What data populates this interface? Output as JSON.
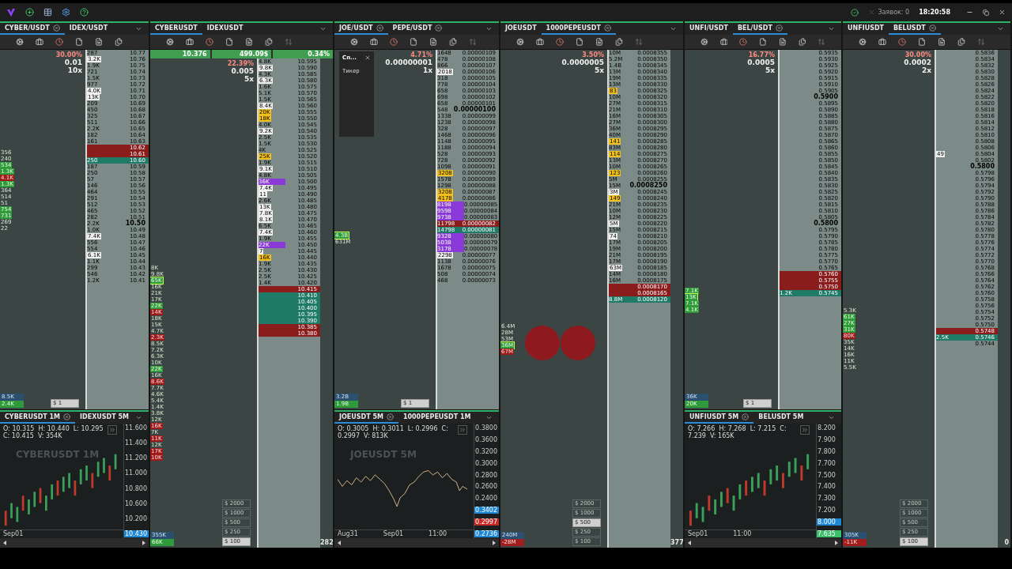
{
  "top_bar": {
    "status": "Заявок: 0",
    "time": "18:20:58"
  },
  "panels": [
    {
      "tabs": [
        {
          "label": "CYBER/USDT",
          "selected": true,
          "closable": true
        },
        {
          "label": "IDEX/USDT",
          "selected": false,
          "closable": false
        }
      ],
      "change": "30.00%",
      "step": "0.01",
      "multiplier": "10x",
      "trades": [
        {
          "text": "356",
          "kind": "text"
        },
        {
          "text": "240",
          "kind": "text"
        },
        {
          "text": "534",
          "kind": "buy"
        },
        {
          "text": "1.3K",
          "kind": "buy"
        },
        {
          "text": "4.1K",
          "kind": "sell"
        },
        {
          "text": "1.3K",
          "kind": "buy"
        },
        {
          "text": "364",
          "kind": "text"
        },
        {
          "text": "514",
          "kind": "text"
        },
        {
          "text": "51",
          "kind": "text"
        },
        {
          "text": "754",
          "kind": "buy"
        },
        {
          "text": "731",
          "kind": "buy"
        },
        {
          "text": "269",
          "kind": "text"
        },
        {
          "text": "22",
          "kind": "text"
        }
      ],
      "totals": [
        {
          "text": "8.5K",
          "kind": "total"
        },
        {
          "text": "2.4K",
          "kind": "buy"
        }
      ],
      "amounts": [
        {
          "label": "$ 1",
          "selected": true
        }
      ],
      "ladder": [
        {
          "price": "10.77",
          "volume": "287"
        },
        {
          "price": "10.76",
          "volume": "3.2K",
          "kind": "white"
        },
        {
          "price": "10.75",
          "volume": "1.9K"
        },
        {
          "price": "10.74",
          "volume": "721"
        },
        {
          "price": "10.73",
          "volume": "1.5K"
        },
        {
          "price": "10.72",
          "volume": "977"
        },
        {
          "price": "10.71",
          "volume": "4.0K",
          "kind": "white"
        },
        {
          "price": "10.70",
          "volume": "13K",
          "kind": "white"
        },
        {
          "price": "10.69",
          "volume": "209"
        },
        {
          "price": "10.68",
          "volume": "450"
        },
        {
          "price": "10.67",
          "volume": "325"
        },
        {
          "price": "10.66",
          "volume": "511"
        },
        {
          "price": "10.65",
          "volume": "2.2K"
        },
        {
          "price": "10.64",
          "volume": "182"
        },
        {
          "price": "10.63",
          "volume": "161"
        },
        {
          "price": "10.62",
          "kind": "ask"
        },
        {
          "price": "10.61",
          "kind": "ask"
        },
        {
          "price": "10.60",
          "volume": "250",
          "kind": "bid"
        },
        {
          "price": "10.59",
          "volume": "187"
        },
        {
          "price": "10.58",
          "volume": "250"
        },
        {
          "price": "10.57",
          "volume": "57"
        },
        {
          "price": "10.56",
          "volume": "146"
        },
        {
          "price": "10.55",
          "volume": "464"
        },
        {
          "price": "10.54",
          "volume": "291"
        },
        {
          "price": "10.53",
          "volume": "512"
        },
        {
          "price": "10.52",
          "volume": "465"
        },
        {
          "price": "10.51",
          "volume": "282"
        },
        {
          "price": "10.50",
          "volume": "2.2K",
          "kind": "round"
        },
        {
          "price": "10.49",
          "volume": "1.0K"
        },
        {
          "price": "10.48",
          "volume": "7.4K",
          "kind": "white"
        },
        {
          "price": "10.47",
          "volume": "556"
        },
        {
          "price": "10.46",
          "volume": "554"
        },
        {
          "price": "10.45",
          "volume": "6.1K",
          "kind": "white"
        },
        {
          "price": "10.44",
          "volume": "1.1K"
        },
        {
          "price": "10.43",
          "volume": "299"
        },
        {
          "price": "10.42",
          "volume": "546"
        },
        {
          "price": "10.41",
          "volume": "1.2K"
        }
      ],
      "chart": {
        "tabs": [
          {
            "label": "CYBERUSDT 1M",
            "selected": true,
            "closable": true
          },
          {
            "label": "IDEXUSDT 5M",
            "selected": false,
            "closable": false
          }
        ],
        "ohlc": "O: 10.315  H: 10.440  L: 10.295  C: 10.415  V: 354K",
        "watermark": "CYBERUSDT 1M",
        "kind": "candles",
        "y_labels": [
          "11.600",
          "11.400",
          "11.200",
          "11.000",
          "10.800",
          "10.600",
          "10.200"
        ],
        "price_tags": [
          {
            "text": "10.430",
            "kind": "blue"
          }
        ],
        "x_labels": [
          "Sep01"
        ]
      }
    },
    {
      "tabs": [
        {
          "label": "CYBERUSDT",
          "selected": true,
          "closable": false
        },
        {
          "label": "IDEXUSDT",
          "selected": false,
          "closable": false
        }
      ],
      "stats": [
        "10.376",
        "499.09$",
        "0.34%"
      ],
      "change": "22.39%",
      "step": "0.005",
      "multiplier": "5x",
      "counter": "282",
      "trades": [
        {
          "text": "8K",
          "kind": "text"
        },
        {
          "text": "9.8K",
          "kind": "text"
        },
        {
          "text": "65K",
          "kind": "big"
        },
        {
          "text": "16K",
          "kind": "text"
        },
        {
          "text": "21K",
          "kind": "text"
        },
        {
          "text": "17K",
          "kind": "text"
        },
        {
          "text": "22K",
          "kind": "buy"
        },
        {
          "text": "14K",
          "kind": "sell"
        },
        {
          "text": "18K",
          "kind": "text"
        },
        {
          "text": "15K",
          "kind": "text"
        },
        {
          "text": "4.7K",
          "kind": "text"
        },
        {
          "text": "2.3K",
          "kind": "sell"
        },
        {
          "text": "8.5K",
          "kind": "text"
        },
        {
          "text": "7.2K",
          "kind": "text"
        },
        {
          "text": "6.3K",
          "kind": "text"
        },
        {
          "text": "10K",
          "kind": "text"
        },
        {
          "text": "22K",
          "kind": "buy"
        },
        {
          "text": "16K",
          "kind": "text"
        },
        {
          "text": "8.6K",
          "kind": "sell"
        },
        {
          "text": "7.7K",
          "kind": "text"
        },
        {
          "text": "4.6K",
          "kind": "text"
        },
        {
          "text": "5.4K",
          "kind": "text"
        },
        {
          "text": "1.4K",
          "kind": "text"
        },
        {
          "text": "3.8K",
          "kind": "text"
        },
        {
          "text": "12K",
          "kind": "text"
        },
        {
          "text": "16K",
          "kind": "sell"
        },
        {
          "text": "7K",
          "kind": "text"
        },
        {
          "text": "11K",
          "kind": "sell"
        },
        {
          "text": "12K",
          "kind": "text"
        },
        {
          "text": "17K",
          "kind": "sell"
        },
        {
          "text": "10K",
          "kind": "sell"
        }
      ],
      "totals": [
        {
          "text": "355K",
          "kind": "total"
        },
        {
          "text": "66K",
          "kind": "buy"
        }
      ],
      "amounts": [
        {
          "label": "$ 2000",
          "selected": false
        },
        {
          "label": "$ 1000",
          "selected": false
        },
        {
          "label": "$ 500",
          "selected": false
        },
        {
          "label": "$ 250",
          "selected": false
        },
        {
          "label": "$ 100",
          "selected": true
        }
      ],
      "ladder": [
        {
          "price": "10.595",
          "volume": "4.8K"
        },
        {
          "price": "10.590",
          "volume": "9.8K",
          "kind": "white"
        },
        {
          "price": "10.585",
          "volume": "4.3K"
        },
        {
          "price": "10.580",
          "volume": "6.3K",
          "kind": "white"
        },
        {
          "price": "10.575",
          "volume": "1.6K"
        },
        {
          "price": "10.570",
          "volume": "5.1K"
        },
        {
          "price": "10.565",
          "volume": "1.5K"
        },
        {
          "price": "10.560",
          "volume": "8.4K",
          "kind": "white"
        },
        {
          "price": "10.555",
          "volume": "20K",
          "kind": "yellow"
        },
        {
          "price": "10.550",
          "volume": "18K",
          "kind": "yellow"
        },
        {
          "price": "10.545",
          "volume": "4.0K"
        },
        {
          "price": "10.540",
          "volume": "9.2K",
          "kind": "white"
        },
        {
          "price": "10.535",
          "volume": "2.5K"
        },
        {
          "price": "10.530",
          "volume": "1.5K"
        },
        {
          "price": "10.525",
          "volume": "4K"
        },
        {
          "price": "10.520",
          "volume": "25K",
          "kind": "yellow"
        },
        {
          "price": "10.515",
          "volume": "1.9K"
        },
        {
          "price": "10.510",
          "volume": "9.1K",
          "kind": "white"
        },
        {
          "price": "10.505",
          "volume": "4.8K"
        },
        {
          "price": "10.500",
          "volume": "36K",
          "kind": "purple"
        },
        {
          "price": "10.495",
          "volume": "7.4K",
          "kind": "white"
        },
        {
          "price": "10.490",
          "volume": "11",
          "kind": "white"
        },
        {
          "price": "10.485",
          "volume": "2.6K"
        },
        {
          "price": "10.480",
          "volume": "13K",
          "kind": "white"
        },
        {
          "price": "10.475",
          "volume": "7.8K",
          "kind": "white"
        },
        {
          "price": "10.470",
          "volume": "8.1K",
          "kind": "white"
        },
        {
          "price": "10.465",
          "volume": "6.5K"
        },
        {
          "price": "10.460",
          "volume": "7.4K",
          "kind": "white"
        },
        {
          "price": "10.455",
          "volume": "1.9K"
        },
        {
          "price": "10.450",
          "volume": "22K",
          "kind": "purple"
        },
        {
          "price": "10.445",
          "volume": "7",
          "kind": "white"
        },
        {
          "price": "10.440",
          "volume": "16K",
          "kind": "yellow"
        },
        {
          "price": "10.435",
          "volume": "1.9K"
        },
        {
          "price": "10.430",
          "volume": "2.5K"
        },
        {
          "price": "10.425",
          "volume": "2.5K"
        },
        {
          "price": "10.420",
          "volume": "1.4K"
        },
        {
          "price": "10.415",
          "kind": "ask"
        },
        {
          "price": "10.410",
          "kind": "bid"
        },
        {
          "price": "10.405",
          "kind": "bid"
        },
        {
          "price": "10.400",
          "kind": "bid"
        },
        {
          "price": "10.395",
          "kind": "bid"
        },
        {
          "price": "10.390",
          "kind": "bid"
        },
        {
          "price": "10.385",
          "kind": "ask"
        },
        {
          "price": "10.380",
          "kind": "ask"
        }
      ]
    },
    {
      "tabs": [
        {
          "label": "JOE/USDT",
          "selected": true,
          "closable": true
        },
        {
          "label": "PEPE/USDT",
          "selected": false,
          "closable": true
        }
      ],
      "change": "4.71%",
      "step": "0.00000001",
      "multiplier": "1x",
      "popup": {
        "title": "Сп...",
        "item": "Тикер"
      },
      "trades": [
        {
          "text": "4.3B",
          "kind": "big"
        },
        {
          "text": "631M",
          "kind": "text"
        }
      ],
      "totals": [
        {
          "text": "3.2B",
          "kind": "total"
        },
        {
          "text": "1.9B",
          "kind": "buy"
        }
      ],
      "amounts": [
        {
          "label": "$ 1",
          "selected": true
        }
      ],
      "ladder": [
        {
          "price": "0.00000109",
          "volume": "1648"
        },
        {
          "price": "0.00000108",
          "volume": "478"
        },
        {
          "price": "0.00000107",
          "volume": "866"
        },
        {
          "price": "0.00000106",
          "volume": "2018",
          "kind": "white"
        },
        {
          "price": "0.00000105",
          "volume": "318"
        },
        {
          "price": "0.00000104",
          "volume": "778"
        },
        {
          "price": "0.00000103",
          "volume": "658"
        },
        {
          "price": "0.00000102",
          "volume": "698"
        },
        {
          "price": "0.00000101",
          "volume": "658"
        },
        {
          "price": "0.00000100",
          "volume": "548",
          "kind": "round"
        },
        {
          "price": "0.00000099",
          "volume": "1338"
        },
        {
          "price": "0.00000098",
          "volume": "1238"
        },
        {
          "price": "0.00000097",
          "volume": "328"
        },
        {
          "price": "0.00000096",
          "volume": "1468"
        },
        {
          "price": "0.00000095",
          "volume": "1148"
        },
        {
          "price": "0.00000094",
          "volume": "1188"
        },
        {
          "price": "0.00000093",
          "volume": "528"
        },
        {
          "price": "0.00000092",
          "volume": "728"
        },
        {
          "price": "0.00000091",
          "volume": "1098"
        },
        {
          "price": "0.00000090",
          "volume": "3208",
          "kind": "yellow"
        },
        {
          "price": "0.00000089",
          "volume": "1578"
        },
        {
          "price": "0.00000088",
          "volume": "1298"
        },
        {
          "price": "0.00000087",
          "volume": "3208",
          "kind": "yellow"
        },
        {
          "price": "0.00000086",
          "volume": "4178",
          "kind": "yellow"
        },
        {
          "price": "0.00000085",
          "volume": "8198",
          "kind": "purple"
        },
        {
          "price": "0.00000084",
          "volume": "9598",
          "kind": "purple"
        },
        {
          "price": "0.00000083",
          "volume": "9738",
          "kind": "purple"
        },
        {
          "price": "0.00000082",
          "volume": "11798",
          "kind": "ask"
        },
        {
          "price": "0.00000081",
          "volume": "14798",
          "kind": "bid"
        },
        {
          "price": "0.00000080",
          "volume": "9328",
          "kind": "purple"
        },
        {
          "price": "0.00000079",
          "volume": "5038",
          "kind": "purple"
        },
        {
          "price": "0.00000078",
          "volume": "3178",
          "kind": "purple"
        },
        {
          "price": "0.00000077",
          "volume": "2298",
          "kind": "white"
        },
        {
          "price": "0.00000076",
          "volume": "1138"
        },
        {
          "price": "0.00000075",
          "volume": "1678"
        },
        {
          "price": "0.00000074",
          "volume": "508"
        },
        {
          "price": "0.00000073",
          "volume": "468"
        }
      ],
      "chart": {
        "tabs": [
          {
            "label": "JOEUSDT 5M",
            "selected": true,
            "closable": true
          },
          {
            "label": "1000PEPEUSDT 1M",
            "selected": false,
            "closable": false
          }
        ],
        "ohlc": "O: 0.3005  H: 0.3011  L: 0.2996  C: 0.2997  V: 813K",
        "watermark": "JOEUSDT 5M",
        "kind": "line",
        "y_labels": [
          "0.3800",
          "0.3600",
          "0.3200",
          "0.3000",
          "0.2800",
          "0.2600",
          "0.2400"
        ],
        "price_tags": [
          {
            "text": "0.3402",
            "kind": "blue"
          },
          {
            "text": "0.2997",
            "kind": "red"
          },
          {
            "text": "0.2736",
            "kind": "blue"
          }
        ],
        "x_labels": [
          "Aug31",
          "Sep01",
          "11:00"
        ]
      }
    },
    {
      "tabs": [
        {
          "label": "JOEUSDT",
          "selected": false,
          "closable": false
        },
        {
          "label": "1000PEPEUSDT",
          "selected": true,
          "closable": true
        }
      ],
      "change": "3.50%",
      "step": "0.0000005",
      "multiplier": "5x",
      "counter": "377",
      "trade_bubbles": true,
      "trades": [
        {
          "text": "6.4M",
          "kind": "text"
        },
        {
          "text": "28M",
          "kind": "text"
        },
        {
          "text": "53M",
          "kind": "text"
        },
        {
          "text": "36M",
          "kind": "big"
        },
        {
          "text": "67M",
          "kind": "sell"
        }
      ],
      "totals": [
        {
          "text": "240M",
          "kind": "total"
        },
        {
          "text": "-28M",
          "kind": "sell"
        }
      ],
      "amounts": [
        {
          "label": "$ 2000",
          "selected": false
        },
        {
          "label": "$ 1000",
          "selected": false
        },
        {
          "label": "$ 500",
          "selected": true
        },
        {
          "label": "$ 250",
          "selected": false
        },
        {
          "label": "$ 100",
          "selected": false
        }
      ],
      "ladder": [
        {
          "price": "0.0008355",
          "volume": "10M"
        },
        {
          "price": "0.0008350",
          "volume": "5.2M"
        },
        {
          "price": "0.0008345",
          "volume": "1.4B"
        },
        {
          "price": "0.0008340",
          "volume": "13M"
        },
        {
          "price": "0.0008335",
          "volume": "19M"
        },
        {
          "price": "0.0008330",
          "volume": "13M"
        },
        {
          "price": "0.0008325",
          "volume": "83",
          "kind": "yellow"
        },
        {
          "price": "0.0008320",
          "volume": "10M"
        },
        {
          "price": "0.0008315",
          "volume": "27M"
        },
        {
          "price": "0.0008310",
          "volume": "21M"
        },
        {
          "price": "0.0008305",
          "volume": "16M"
        },
        {
          "price": "0.0008300",
          "volume": "27M"
        },
        {
          "price": "0.0008295",
          "volume": "36M"
        },
        {
          "price": "0.0008290",
          "volume": "40M"
        },
        {
          "price": "0.0008285",
          "volume": "141",
          "kind": "yellow"
        },
        {
          "price": "0.0008280",
          "volume": "83M"
        },
        {
          "price": "0.0008275",
          "volume": "114",
          "kind": "yellow"
        },
        {
          "price": "0.0008270",
          "volume": "13M"
        },
        {
          "price": "0.0008265",
          "volume": "10M"
        },
        {
          "price": "0.0008260",
          "volume": "123",
          "kind": "yellow"
        },
        {
          "price": "0.0008255",
          "volume": "5M"
        },
        {
          "price": "0.0008250",
          "volume": "15M",
          "kind": "round"
        },
        {
          "price": "0.0008245",
          "volume": "3M",
          "kind": "white"
        },
        {
          "price": "0.0008240",
          "volume": "149",
          "kind": "yellow"
        },
        {
          "price": "0.0008235",
          "volume": "21M"
        },
        {
          "price": "0.0008230",
          "volume": "10M"
        },
        {
          "price": "0.0008225",
          "volume": "12M"
        },
        {
          "price": "0.0008220",
          "volume": "5M",
          "kind": "white"
        },
        {
          "price": "0.0008215",
          "volume": "15M"
        },
        {
          "price": "0.0008210",
          "volume": "74",
          "kind": "white"
        },
        {
          "price": "0.0008205",
          "volume": "17M"
        },
        {
          "price": "0.0008200",
          "volume": "19M"
        },
        {
          "price": "0.0008195",
          "volume": "21M"
        },
        {
          "price": "0.0008190",
          "volume": "17M"
        },
        {
          "price": "0.0008185",
          "volume": "63M",
          "kind": "white"
        },
        {
          "price": "0.0008180",
          "volume": "14M"
        },
        {
          "price": "0.0008175",
          "volume": "16M"
        },
        {
          "price": "0.0008170",
          "kind": "ask"
        },
        {
          "price": "0.0008165",
          "kind": "ask"
        },
        {
          "price": "0.0008120",
          "volume": "8.8M",
          "kind": "bid"
        }
      ]
    },
    {
      "tabs": [
        {
          "label": "UNFI/USDT",
          "selected": false,
          "closable": false
        },
        {
          "label": "BEL/USDT",
          "selected": true,
          "closable": true
        }
      ],
      "change": "16.77%",
      "step": "0.0005",
      "multiplier": "5x",
      "trades": [
        {
          "text": "7.1K",
          "kind": "buy"
        },
        {
          "text": "13K",
          "kind": "big"
        },
        {
          "text": "7.1K",
          "kind": "buy"
        },
        {
          "text": "4.1K",
          "kind": "buy"
        }
      ],
      "totals": [
        {
          "text": "36K",
          "kind": "total"
        },
        {
          "text": "20K",
          "kind": "buy"
        }
      ],
      "amounts": [
        {
          "label": "$ 1",
          "selected": true
        }
      ],
      "ladder": [
        {
          "price": "0.5935"
        },
        {
          "price": "0.5930"
        },
        {
          "price": "0.5925"
        },
        {
          "price": "0.5920"
        },
        {
          "price": "0.5915"
        },
        {
          "price": "0.5910"
        },
        {
          "price": "0.5905"
        },
        {
          "price": "0.5900",
          "kind": "round"
        },
        {
          "price": "0.5895"
        },
        {
          "price": "0.5890"
        },
        {
          "price": "0.5885"
        },
        {
          "price": "0.5880"
        },
        {
          "price": "0.5875"
        },
        {
          "price": "0.5870"
        },
        {
          "price": "0.5865"
        },
        {
          "price": "0.5860"
        },
        {
          "price": "0.5855"
        },
        {
          "price": "0.5850"
        },
        {
          "price": "0.5845"
        },
        {
          "price": "0.5840"
        },
        {
          "price": "0.5835"
        },
        {
          "price": "0.5830"
        },
        {
          "price": "0.5825"
        },
        {
          "price": "0.5820"
        },
        {
          "price": "0.5815"
        },
        {
          "price": "0.5810"
        },
        {
          "price": "0.5805"
        },
        {
          "price": "0.5800",
          "kind": "round"
        },
        {
          "price": "0.5795"
        },
        {
          "price": "0.5790"
        },
        {
          "price": "0.5785"
        },
        {
          "price": "0.5780"
        },
        {
          "price": "0.5775"
        },
        {
          "price": "0.5770"
        },
        {
          "price": "0.5765"
        },
        {
          "price": "0.5760",
          "kind": "ask"
        },
        {
          "price": "0.5755",
          "kind": "ask"
        },
        {
          "price": "0.5750",
          "kind": "ask"
        },
        {
          "price": "0.5745",
          "volume": "1.2K",
          "kind": "bid"
        }
      ],
      "chart": {
        "tabs": [
          {
            "label": "UNFIUSDT 5M",
            "selected": true,
            "closable": true
          },
          {
            "label": "BELUSDT 5M",
            "selected": false,
            "closable": false
          }
        ],
        "ohlc": "O: 7.266  H: 7.268  L: 7.215  C: 7.239  V: 165K",
        "kind": "candles",
        "y_labels": [
          "8.200",
          "7.900",
          "7.800",
          "7.700",
          "7.500",
          "7.400",
          "7.300",
          "7.200"
        ],
        "price_tags": [
          {
            "text": "8.000",
            "kind": "blue"
          },
          {
            "text": "7.635",
            "kind": "green"
          }
        ],
        "x_labels": [
          "Sep01",
          "11:00"
        ]
      }
    },
    {
      "tabs": [
        {
          "label": "UNFIUSDT",
          "selected": false,
          "closable": false
        },
        {
          "label": "BELUSDT",
          "selected": true,
          "closable": true
        }
      ],
      "change": "30.00%",
      "step": "0.0002",
      "multiplier": "2x",
      "counter": "0",
      "trades": [
        {
          "text": "5.3K",
          "kind": "text"
        },
        {
          "text": "61K",
          "kind": "buy"
        },
        {
          "text": "27K",
          "kind": "buy"
        },
        {
          "text": "31K",
          "kind": "buy"
        },
        {
          "text": "80K",
          "kind": "sell"
        },
        {
          "text": "35K",
          "kind": "text"
        },
        {
          "text": "14K",
          "kind": "text"
        },
        {
          "text": "16K",
          "kind": "text"
        },
        {
          "text": "11K",
          "kind": "text"
        },
        {
          "text": "5.5K",
          "kind": "text"
        }
      ],
      "totals": [
        {
          "text": "305K",
          "kind": "total"
        },
        {
          "text": "-11K",
          "kind": "sell"
        }
      ],
      "amounts": [
        {
          "label": "$ 2000",
          "selected": false
        },
        {
          "label": "$ 1000",
          "selected": false
        },
        {
          "label": "$ 500",
          "selected": false
        },
        {
          "label": "$ 250",
          "selected": false
        },
        {
          "label": "$ 100",
          "selected": true
        }
      ],
      "ladder": [
        {
          "price": "0.5836"
        },
        {
          "price": "0.5834"
        },
        {
          "price": "0.5832"
        },
        {
          "price": "0.5830"
        },
        {
          "price": "0.5828"
        },
        {
          "price": "0.5826"
        },
        {
          "price": "0.5824"
        },
        {
          "price": "0.5822"
        },
        {
          "price": "0.5820"
        },
        {
          "price": "0.5818"
        },
        {
          "price": "0.5816"
        },
        {
          "price": "0.5814"
        },
        {
          "price": "0.5812"
        },
        {
          "price": "0.5810"
        },
        {
          "price": "0.5808"
        },
        {
          "price": "0.5806"
        },
        {
          "price": "0.5804",
          "volume": "49",
          "kind": "white"
        },
        {
          "price": "0.5802"
        },
        {
          "price": "0.5800",
          "kind": "round"
        },
        {
          "price": "0.5798"
        },
        {
          "price": "0.5796"
        },
        {
          "price": "0.5794"
        },
        {
          "price": "0.5792"
        },
        {
          "price": "0.5790"
        },
        {
          "price": "0.5788"
        },
        {
          "price": "0.5786"
        },
        {
          "price": "0.5784"
        },
        {
          "price": "0.5782"
        },
        {
          "price": "0.5780"
        },
        {
          "price": "0.5778"
        },
        {
          "price": "0.5776"
        },
        {
          "price": "0.5774"
        },
        {
          "price": "0.5772"
        },
        {
          "price": "0.5770"
        },
        {
          "price": "0.5768"
        },
        {
          "price": "0.5766"
        },
        {
          "price": "0.5764"
        },
        {
          "price": "0.5762"
        },
        {
          "price": "0.5760"
        },
        {
          "price": "0.5758"
        },
        {
          "price": "0.5756"
        },
        {
          "price": "0.5754"
        },
        {
          "price": "0.5752"
        },
        {
          "price": "0.5750"
        },
        {
          "price": "0.5748",
          "kind": "ask"
        },
        {
          "price": "0.5746",
          "volume": "2.5K",
          "kind": "bid"
        },
        {
          "price": "0.5744"
        }
      ]
    }
  ]
}
